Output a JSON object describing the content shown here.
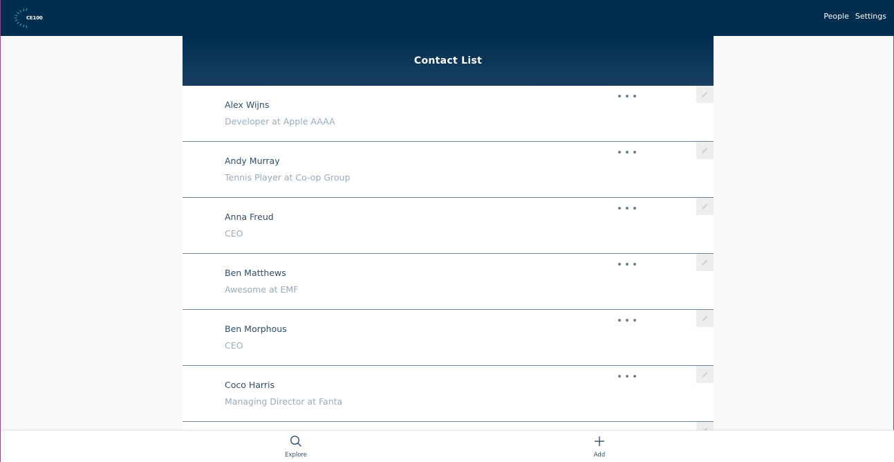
{
  "header": {
    "logo_text": "CE100",
    "nav": [
      {
        "label": "People"
      },
      {
        "label": "Settings"
      }
    ]
  },
  "panel": {
    "title": "Contact List"
  },
  "contacts": [
    {
      "name": "Alex Wijns",
      "subtitle": "Developer at Apple AAAA"
    },
    {
      "name": "Andy Murray",
      "subtitle": "Tennis Player at Co-op Group"
    },
    {
      "name": "Anna Freud",
      "subtitle": "CEO"
    },
    {
      "name": "Ben Matthews",
      "subtitle": "Awesome at EMF"
    },
    {
      "name": "Ben Morphous",
      "subtitle": "CEO"
    },
    {
      "name": "Coco Harris",
      "subtitle": "Managing Director at Fanta"
    }
  ],
  "bottom_nav": {
    "explore_label": "Explore",
    "explore_icon": "search-icon",
    "add_label": "Add",
    "add_icon": "plus-icon"
  },
  "colors": {
    "primary": "#002e4f",
    "name_text": "#2f4d68",
    "subtitle_text": "#9aaab8"
  }
}
